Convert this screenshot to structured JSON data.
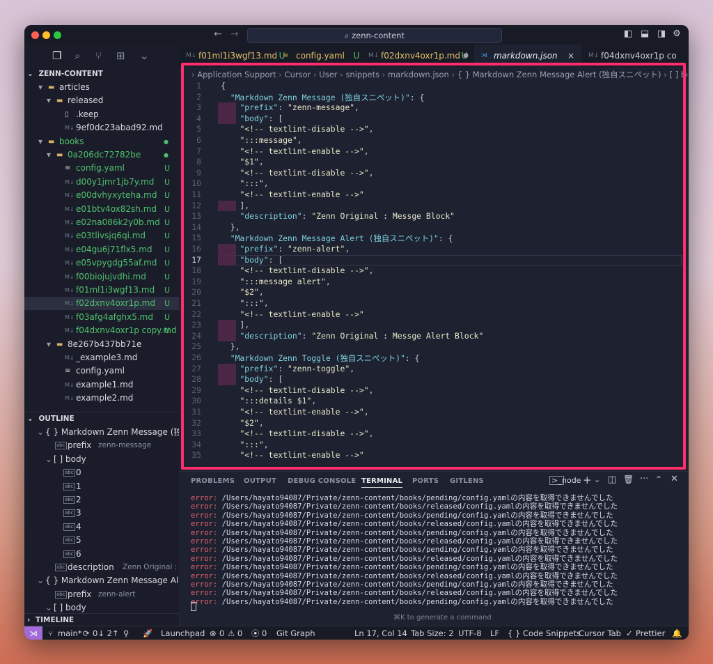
{
  "titlebar": {
    "search": "zenn-content"
  },
  "explorer": {
    "root": "ZENN-CONTENT",
    "items": [
      {
        "label": "articles",
        "indent": 1,
        "type": "folder",
        "open": true
      },
      {
        "label": "released",
        "indent": 2,
        "type": "folder",
        "open": true
      },
      {
        "label": ".keep",
        "indent": 3,
        "type": "file"
      },
      {
        "label": "9ef0dc23abad92.md",
        "indent": 3,
        "type": "md"
      },
      {
        "label": "books",
        "indent": 1,
        "type": "folder",
        "open": true,
        "color": "#4fc06e",
        "dot": true
      },
      {
        "label": "0a206dc72782be",
        "indent": 2,
        "type": "folder",
        "open": true,
        "color": "#4fc06e",
        "dot": true
      },
      {
        "label": "config.yaml",
        "indent": 3,
        "type": "yaml",
        "color": "#4fc06e",
        "badge": "U"
      },
      {
        "label": "d00y1jmr1jb7y.md",
        "indent": 3,
        "type": "md",
        "color": "#4fc06e",
        "badge": "U"
      },
      {
        "label": "e00dvhyxyteha.md",
        "indent": 3,
        "type": "md",
        "color": "#4fc06e",
        "badge": "U"
      },
      {
        "label": "e01btv4ox82sh.md",
        "indent": 3,
        "type": "md",
        "color": "#4fc06e",
        "badge": "U"
      },
      {
        "label": "e02na086k2y0b.md",
        "indent": 3,
        "type": "md",
        "color": "#4fc06e",
        "badge": "U"
      },
      {
        "label": "e03tlivsjq6qi.md",
        "indent": 3,
        "type": "md",
        "color": "#4fc06e",
        "badge": "U"
      },
      {
        "label": "e04gu6j71flx5.md",
        "indent": 3,
        "type": "md",
        "color": "#4fc06e",
        "badge": "U"
      },
      {
        "label": "e05vpygdg55af.md",
        "indent": 3,
        "type": "md",
        "color": "#4fc06e",
        "badge": "U"
      },
      {
        "label": "f00biojujvdhi.md",
        "indent": 3,
        "type": "md",
        "color": "#4fc06e",
        "badge": "U"
      },
      {
        "label": "f01ml1i3wgf13.md",
        "indent": 3,
        "type": "md",
        "color": "#4fc06e",
        "badge": "U"
      },
      {
        "label": "f02dxnv4oxr1p.md",
        "indent": 3,
        "type": "md",
        "color": "#4fc06e",
        "badge": "U",
        "selected": true
      },
      {
        "label": "f03afg4afghx5.md",
        "indent": 3,
        "type": "md",
        "color": "#4fc06e",
        "badge": "U"
      },
      {
        "label": "f04dxnv4oxr1p copy.md",
        "indent": 3,
        "type": "md",
        "color": "#4fc06e",
        "badge": "U"
      },
      {
        "label": "8e267b437bb71e",
        "indent": 2,
        "type": "folder",
        "open": true
      },
      {
        "label": "_example3.md",
        "indent": 3,
        "type": "md"
      },
      {
        "label": "config.yaml",
        "indent": 3,
        "type": "yaml"
      },
      {
        "label": "example1.md",
        "indent": 3,
        "type": "md"
      },
      {
        "label": "example2.md",
        "indent": 3,
        "type": "md"
      }
    ]
  },
  "outline": {
    "title": "OUTLINE",
    "items": [
      {
        "label": "{ } Markdown Zenn Message (独自...",
        "indent": 1,
        "chev": "⌄"
      },
      {
        "label": "prefix",
        "detail": "zenn-message",
        "indent": 3,
        "icon": "abc"
      },
      {
        "label": "[ ] body",
        "indent": 2,
        "chev": "⌄"
      },
      {
        "label": "0",
        "indent": 4,
        "icon": "abc"
      },
      {
        "label": "1",
        "indent": 4,
        "icon": "abc"
      },
      {
        "label": "2",
        "indent": 4,
        "icon": "abc"
      },
      {
        "label": "3",
        "indent": 4,
        "icon": "abc"
      },
      {
        "label": "4",
        "indent": 4,
        "icon": "abc"
      },
      {
        "label": "5",
        "indent": 4,
        "icon": "abc"
      },
      {
        "label": "6",
        "indent": 4,
        "icon": "abc"
      },
      {
        "label": "description",
        "detail": "Zenn Original : Mess...",
        "indent": 3,
        "icon": "abc"
      },
      {
        "label": "{ } Markdown Zenn Message Alert ...",
        "indent": 1,
        "chev": "⌄"
      },
      {
        "label": "prefix",
        "detail": "zenn-alert",
        "indent": 3,
        "icon": "abc"
      },
      {
        "label": "[ ] body",
        "indent": 2,
        "chev": "⌄"
      }
    ]
  },
  "timeline": "TIMELINE",
  "tabs": [
    {
      "label": "f01ml1i3wgf13.md",
      "badge": "U",
      "icon": "md"
    },
    {
      "label": "config.yaml",
      "badge": "U",
      "icon": "yaml"
    },
    {
      "label": "f02dxnv4oxr1p.md",
      "badge": "U",
      "icon": "md",
      "dot": true
    },
    {
      "label": "markdown.json",
      "icon": "vscode",
      "active": true,
      "close": "×"
    },
    {
      "label": "f04dxnv4oxr1p co",
      "icon": "md"
    }
  ],
  "breadcrumb": [
    "Application Support",
    "Cursor",
    "User",
    "snippets",
    "markdown.json",
    "{ } Markdown Zenn Message Alert (独自スニペット)",
    "[ ] body"
  ],
  "code": [
    "{",
    "  \"Markdown Zenn Message (独自スニペット)\": {",
    "    \"prefix\": \"zenn-message\",",
    "    \"body\": [",
    "    \"<!-- textlint-disable -->\",",
    "    \":::message\",",
    "    \"<!-- textlint-enable -->\",",
    "    \"$1\",",
    "    \"<!-- textlint-disable -->\",",
    "    \":::\",",
    "    \"<!-- textlint-enable -->\"",
    "    ],",
    "    \"description\": \"Zenn Original : Messge Block\"",
    "  },",
    "  \"Markdown Zenn Message Alert (独自スニペット)\": {",
    "    \"prefix\": \"zenn-alert\",",
    "    \"body\": [",
    "    \"<!-- textlint-disable -->\",",
    "    \":::message alert\",",
    "    \"$2\",",
    "    \":::\",",
    "    \"<!-- textlint-enable -->\"",
    "    ],",
    "    \"description\": \"Zenn Original : Messge Alert Block\"",
    "  },",
    "  \"Markdown Zenn Toggle (独自スニペット)\": {",
    "    \"prefix\": \"zenn-toggle\",",
    "    \"body\": [",
    "    \"<!-- textlint-disable -->\",",
    "    \":::details $1\",",
    "    \"<!-- textlint-enable -->\",",
    "    \"$2\",",
    "    \"<!-- textlint-disable -->\",",
    "    \":::\",",
    "    \"<!-- textlint-enable -->\""
  ],
  "panel": {
    "tabs": [
      "PROBLEMS",
      "OUTPUT",
      "DEBUG CONSOLE",
      "TERMINAL",
      "PORTS",
      "GITLENS"
    ],
    "active": "TERMINAL",
    "terminal_name": "node",
    "lines": [
      "/Users/hayato94087/Private/zenn-content/books/pending/config.yamlの内容を取得できませんでした",
      "/Users/hayato94087/Private/zenn-content/books/released/config.yamlの内容を取得できませんでした",
      "/Users/hayato94087/Private/zenn-content/books/pending/config.yamlの内容を取得できませんでした",
      "/Users/hayato94087/Private/zenn-content/books/released/config.yamlの内容を取得できませんでした",
      "/Users/hayato94087/Private/zenn-content/books/pending/config.yamlの内容を取得できませんでした",
      "/Users/hayato94087/Private/zenn-content/books/released/config.yamlの内容を取得できませんでした",
      "/Users/hayato94087/Private/zenn-content/books/pending/config.yamlの内容を取得できませんでした",
      "/Users/hayato94087/Private/zenn-content/books/released/config.yamlの内容を取得できませんでした",
      "/Users/hayato94087/Private/zenn-content/books/pending/config.yamlの内容を取得できませんでした",
      "/Users/hayato94087/Private/zenn-content/books/released/config.yamlの内容を取得できませんでした",
      "/Users/hayato94087/Private/zenn-content/books/pending/config.yamlの内容を取得できませんでした",
      "/Users/hayato94087/Private/zenn-content/books/released/config.yamlの内容を取得できませんでした",
      "/Users/hayato94087/Private/zenn-content/books/pending/config.yamlの内容を取得できませんでした"
    ],
    "error_prefix": "error:",
    "hint": "⌘K to generate a command"
  },
  "status": {
    "branch": "main*",
    "sync": "0↓ 2↑",
    "launchpad": "Launchpad",
    "errors": "0",
    "warnings": "0",
    "ports": "0",
    "git_graph": "Git Graph",
    "position": "Ln 17, Col 14",
    "tab_size": "Tab Size: 2",
    "encoding": "UTF-8",
    "eol": "LF",
    "language": "{ }  Code Snippets",
    "cursor_tab": "Cursor Tab",
    "prettier": "Prettier"
  }
}
